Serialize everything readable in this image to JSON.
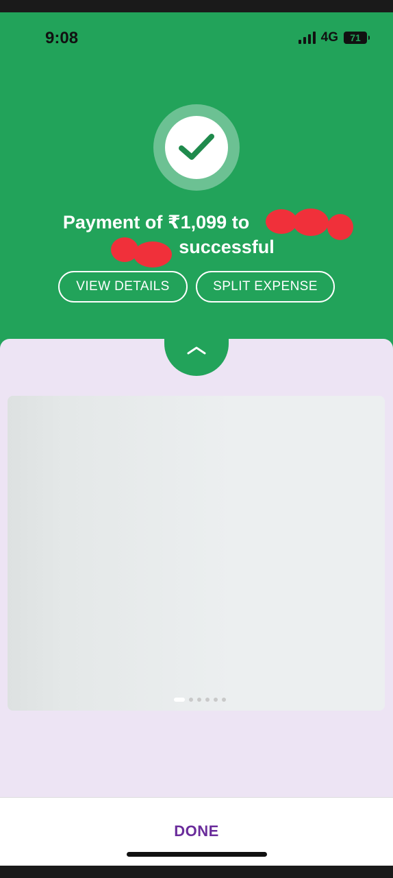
{
  "status_bar": {
    "time": "9:08",
    "network": "4G",
    "battery": "71"
  },
  "payment": {
    "headline_line1": "Payment of ₹1,099 to",
    "headline_line2": "successful",
    "status_icon": "check-icon"
  },
  "actions": {
    "view_details_label": "VIEW DETAILS",
    "split_expense_label": "SPLIT EXPENSE"
  },
  "sheet": {
    "expand_icon": "chevron-up-icon",
    "carousel_pages": 6,
    "carousel_active_index": 0
  },
  "footer": {
    "done_label": "DONE"
  },
  "colors": {
    "brand_green": "#22a35a",
    "sheet_bg": "#ede4f4",
    "done_purple": "#6a2c9b",
    "redaction": "#f0303a"
  }
}
